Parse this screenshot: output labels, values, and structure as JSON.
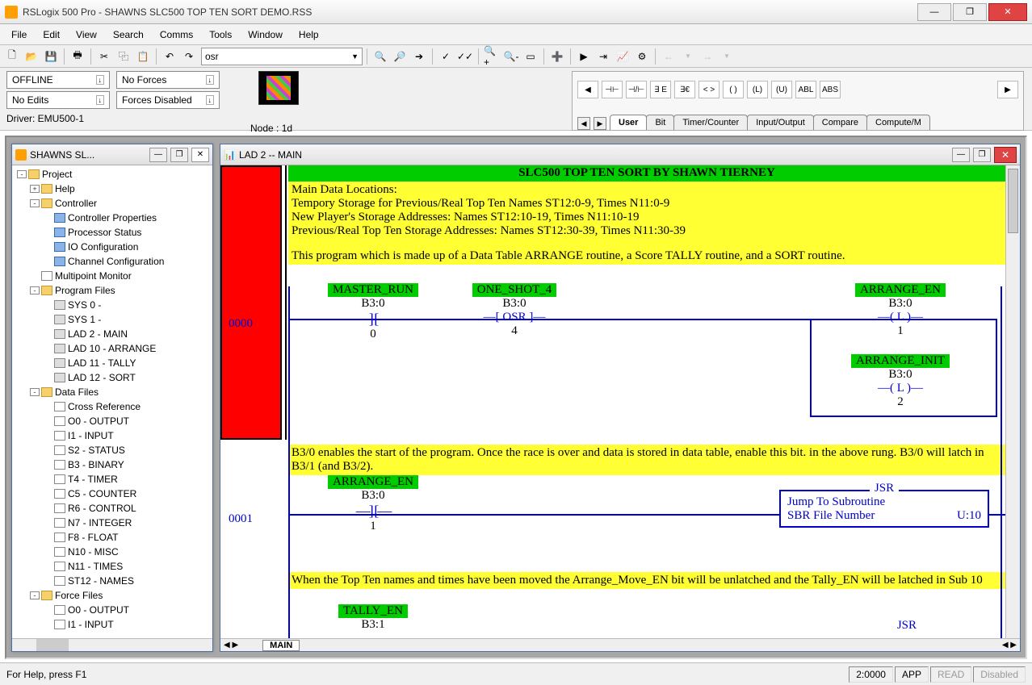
{
  "title": "RSLogix 500 Pro - SHAWNS SLC500 TOP TEN SORT DEMO.RSS",
  "menu": [
    "File",
    "Edit",
    "View",
    "Search",
    "Comms",
    "Tools",
    "Window",
    "Help"
  ],
  "combo_text": "osr",
  "ctrl": {
    "offline": "OFFLINE",
    "noforces": "No Forces",
    "noedits": "No Edits",
    "forcesdisabled": "Forces Disabled",
    "driver": "Driver: EMU500-1",
    "node": "Node : 1d"
  },
  "palette_tabs": [
    "User",
    "Bit",
    "Timer/Counter",
    "Input/Output",
    "Compare",
    "Compute/M"
  ],
  "palette_btns": [
    "⊣⊢",
    "⊣/⊢",
    "∃ E",
    "∃€",
    "< >",
    "( )",
    "(L)",
    "(U)",
    "ABL",
    "ABS"
  ],
  "tree_title": "SHAWNS SL...",
  "tree": [
    {
      "d": 0,
      "e": "-",
      "i": "folder",
      "t": "Project"
    },
    {
      "d": 1,
      "e": "+",
      "i": "folder",
      "t": "Help"
    },
    {
      "d": 1,
      "e": "-",
      "i": "folder",
      "t": "Controller"
    },
    {
      "d": 2,
      "e": "",
      "i": "ctrl",
      "t": "Controller Properties"
    },
    {
      "d": 2,
      "e": "",
      "i": "ctrl",
      "t": "Processor Status"
    },
    {
      "d": 2,
      "e": "",
      "i": "ctrl",
      "t": "IO Configuration"
    },
    {
      "d": 2,
      "e": "",
      "i": "ctrl",
      "t": "Channel Configuration"
    },
    {
      "d": 1,
      "e": "",
      "i": "file",
      "t": "Multipoint Monitor"
    },
    {
      "d": 1,
      "e": "-",
      "i": "folder",
      "t": "Program Files"
    },
    {
      "d": 2,
      "e": "",
      "i": "lad",
      "t": "SYS 0 -"
    },
    {
      "d": 2,
      "e": "",
      "i": "lad",
      "t": "SYS 1 -"
    },
    {
      "d": 2,
      "e": "",
      "i": "lad",
      "t": "LAD 2 - MAIN"
    },
    {
      "d": 2,
      "e": "",
      "i": "lad",
      "t": "LAD 10 - ARRANGE"
    },
    {
      "d": 2,
      "e": "",
      "i": "lad",
      "t": "LAD 11 - TALLY"
    },
    {
      "d": 2,
      "e": "",
      "i": "lad",
      "t": "LAD 12 - SORT"
    },
    {
      "d": 1,
      "e": "-",
      "i": "folder",
      "t": "Data Files"
    },
    {
      "d": 2,
      "e": "",
      "i": "file",
      "t": "Cross Reference"
    },
    {
      "d": 2,
      "e": "",
      "i": "file",
      "t": "O0 - OUTPUT"
    },
    {
      "d": 2,
      "e": "",
      "i": "file",
      "t": "I1 - INPUT"
    },
    {
      "d": 2,
      "e": "",
      "i": "file",
      "t": "S2 - STATUS"
    },
    {
      "d": 2,
      "e": "",
      "i": "file",
      "t": "B3 - BINARY"
    },
    {
      "d": 2,
      "e": "",
      "i": "file",
      "t": "T4 - TIMER"
    },
    {
      "d": 2,
      "e": "",
      "i": "file",
      "t": "C5 - COUNTER"
    },
    {
      "d": 2,
      "e": "",
      "i": "file",
      "t": "R6 - CONTROL"
    },
    {
      "d": 2,
      "e": "",
      "i": "file",
      "t": "N7 - INTEGER"
    },
    {
      "d": 2,
      "e": "",
      "i": "file",
      "t": "F8 - FLOAT"
    },
    {
      "d": 2,
      "e": "",
      "i": "file",
      "t": "N10 - MISC"
    },
    {
      "d": 2,
      "e": "",
      "i": "file",
      "t": "N11 - TIMES"
    },
    {
      "d": 2,
      "e": "",
      "i": "file",
      "t": "ST12 - NAMES"
    },
    {
      "d": 1,
      "e": "-",
      "i": "folder",
      "t": "Force Files"
    },
    {
      "d": 2,
      "e": "",
      "i": "file",
      "t": "O0 - OUTPUT"
    },
    {
      "d": 2,
      "e": "",
      "i": "file",
      "t": "I1 - INPUT"
    }
  ],
  "lad_title": "LAD 2 -- MAIN",
  "prog_title": "SLC500 TOP TEN SORT BY SHAWN TIERNEY",
  "comment0_l1": "Main Data Locations:",
  "comment0_l2": "Tempory Storage for Previous/Real Top Ten      Names ST12:0-9,      Times N11:0-9",
  "comment0_l3": "New Player's Storage Addresses:                            Names ST12:10-19, Times N11:10-19",
  "comment0_l4": "Previous/Real Top Ten Storage Addresses:          Names ST12:30-39, Times N11:30-39",
  "comment0_l5": "This program which is made up of a Data Table ARRANGE routine, a Score TALLY routine, and a SORT routine.",
  "r0": {
    "num": "0000",
    "master_run": "MASTER_RUN",
    "mr_addr": "B3:0",
    "mr_bit": "0",
    "one_shot": "ONE_SHOT_4",
    "os_addr": "B3:0",
    "os_inst": "OSR",
    "os_bit": "4",
    "arr_en": "ARRANGE_EN",
    "ae_addr": "B3:0",
    "ae_inst": "L",
    "ae_bit": "1",
    "arr_init": "ARRANGE_INIT",
    "ai_addr": "B3:0",
    "ai_inst": "L",
    "ai_bit": "2"
  },
  "comment1": "B3/0 enables the start of the program. Once the race is over and data is stored in data table, enable this bit. in the above rung. B3/0 will latch in B3/1 (and B3/2).",
  "r1": {
    "num": "0001",
    "arr_en": "ARRANGE_EN",
    "ae_addr": "B3:0",
    "ae_bit": "1",
    "jsr_t": "JSR",
    "jsr_l1": "Jump To Subroutine",
    "jsr_l2": "SBR File Number",
    "jsr_v": "U:10"
  },
  "comment2": "When the Top Ten names and times have been moved the Arrange_Move_EN bit will be unlatched and the Tally_EN will be latched in Sub 10",
  "r2": {
    "tally": "TALLY_EN",
    "addr": "B3:1",
    "jsr": "JSR"
  },
  "lad_tab": "MAIN",
  "status": {
    "help": "For Help, press F1",
    "pos": "2:0000",
    "app": "APP",
    "read": "READ",
    "dis": "Disabled"
  }
}
